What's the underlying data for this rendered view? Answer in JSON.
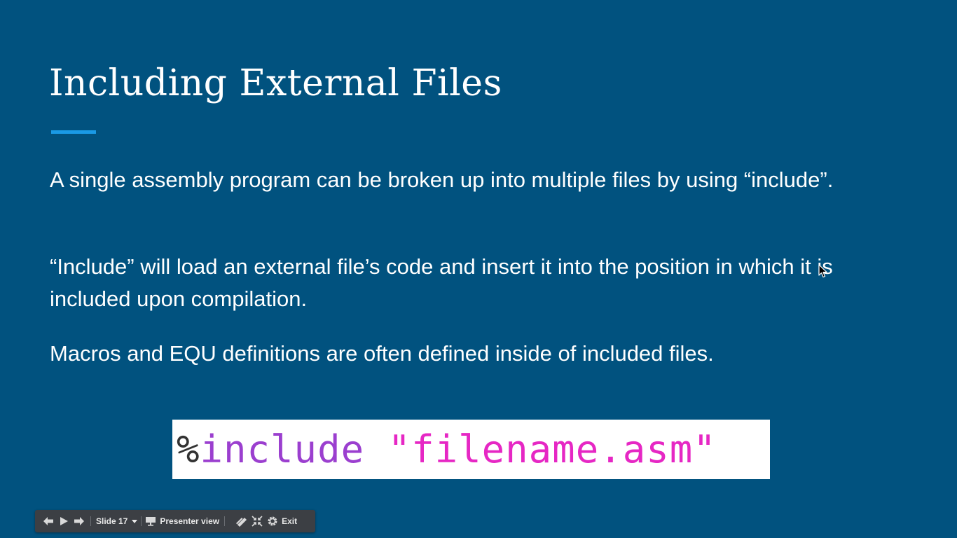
{
  "slide": {
    "title": "Including External Files",
    "paragraphs": [
      "A single assembly program can be broken up into multiple files by using “include”.",
      "“Include” will load an external file’s code and insert it into the position in which it is included upon compilation.",
      "Macros and EQU definitions are often defined inside of included files."
    ],
    "code": {
      "percent": "%",
      "directive": "include",
      "space": " ",
      "string": "\"filename.asm\""
    }
  },
  "toolbar": {
    "slide_label": "Slide 17",
    "presenter_label": "Presenter view",
    "exit_label": "Exit",
    "icons": [
      "prev-icon",
      "play-icon",
      "next-icon",
      "presenter-icon",
      "pen-icon",
      "fullscreen-exit-icon",
      "settings-icon"
    ]
  },
  "colors": {
    "background": "#01527f",
    "accent_bar": "#1a9ae6",
    "code_directive": "#9b3fcf",
    "code_string": "#e627c4",
    "toolbar_bg": "#3c3f44"
  }
}
